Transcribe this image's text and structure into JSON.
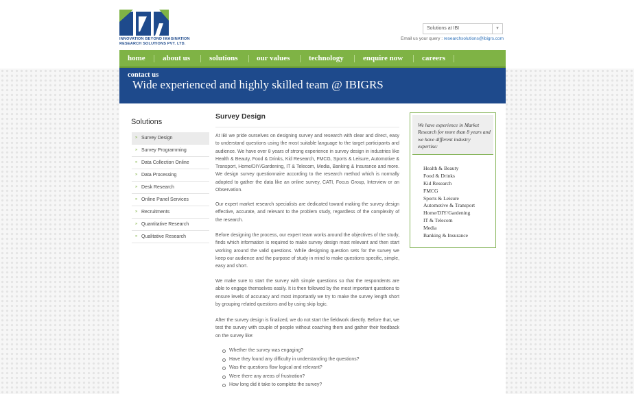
{
  "brand": {
    "logo_text": "IBI",
    "tagline_1": "INNOVATION BEYOND IMAGINATION",
    "tagline_2": "RESEARCH SOLUTIONS PVT. LTD."
  },
  "header": {
    "select_value": "Solutions at IBI",
    "email_label": "Email us your query :",
    "email_link": "researchsolutions@ibigrs.com"
  },
  "nav": {
    "items": [
      {
        "label": "home"
      },
      {
        "label": "about us"
      },
      {
        "label": "solutions"
      },
      {
        "label": "our values"
      },
      {
        "label": "technology"
      },
      {
        "label": "enquire now"
      },
      {
        "label": "careers"
      }
    ],
    "contact_label": "contact us"
  },
  "banner": {
    "title": "Wide experienced and highly skilled team @ IBIGRS"
  },
  "sidebar": {
    "title": "Solutions",
    "items": [
      {
        "label": "Survey Design"
      },
      {
        "label": "Survey Programming"
      },
      {
        "label": "Data Collection Online"
      },
      {
        "label": "Data Processing"
      },
      {
        "label": "Desk Research"
      },
      {
        "label": "Online Panel Services"
      },
      {
        "label": "Recruitments"
      },
      {
        "label": "Quantitative Research"
      },
      {
        "label": "Qualitative Research"
      }
    ]
  },
  "main": {
    "title": "Survey Design",
    "paragraphs": [
      "At IBI we pride ourselves on designing survey and research with clear and direct, easy to understand questions using the most suitable language to the target participants and audience. We have over 8 years of strong experience in survey design in industries like Health & Beauty, Food & Drinks, Kid Research, FMCG, Sports & Leisure, Automotive & Transport, Home/DIY/Gardening, IT & Telecom, Media, Banking & Insurance and more. We design survey questionnaire according to the research method which is normally adopted to gather the data like an online survey, CATI, Focus Group, Interview or an Observation.",
      "Our expert market research specialists are dedicated toward making the survey design effective, accurate, and relevant to the problem study, regardless of the complexity of the research.",
      "Before designing the process, our expert team works around the objectives of the study, finds which information is required to make survey design most relevant and then start working around the valid questions. While designing question sets for the survey we keep our audience and the purpose of study in mind to make questions specific, simple, easy and short.",
      "We make sure to start the survey with simple questions so that the respondents are able to engage themselves easily. It is then followed by the most important questions to ensure levels of accuracy and most importantly we try to make the survey length short by grouping related questions and by using skip logic.",
      "After the survey design is finalized, we do not start the fieldwork directly. Before that, we test the survey with couple of people without coaching them and gather their feedback on the survey like:"
    ],
    "bullets": [
      "Whether the survey was engaging?",
      "Have they found any difficulty in understanding the questions?",
      "Was the questions flow logical and relevant?",
      "Were there any areas of frustration?",
      "How long did it take to complete the survey?"
    ]
  },
  "experience": {
    "heading": "We have experience in Market Research for more than 8 years and we have different industry expertise:",
    "items": [
      "Health & Beauty",
      "Food & Drinks",
      "Kid Research",
      "FMCG",
      "Sports & Leisure",
      "Automotive & Transport",
      "Home/DIY/Gardening",
      "IT & Telecom",
      "Media",
      "Banking & Insurance"
    ]
  },
  "colors": {
    "nav_green": "#7fb345",
    "banner_blue": "#1e4a8c",
    "box_border": "#86b55a"
  }
}
